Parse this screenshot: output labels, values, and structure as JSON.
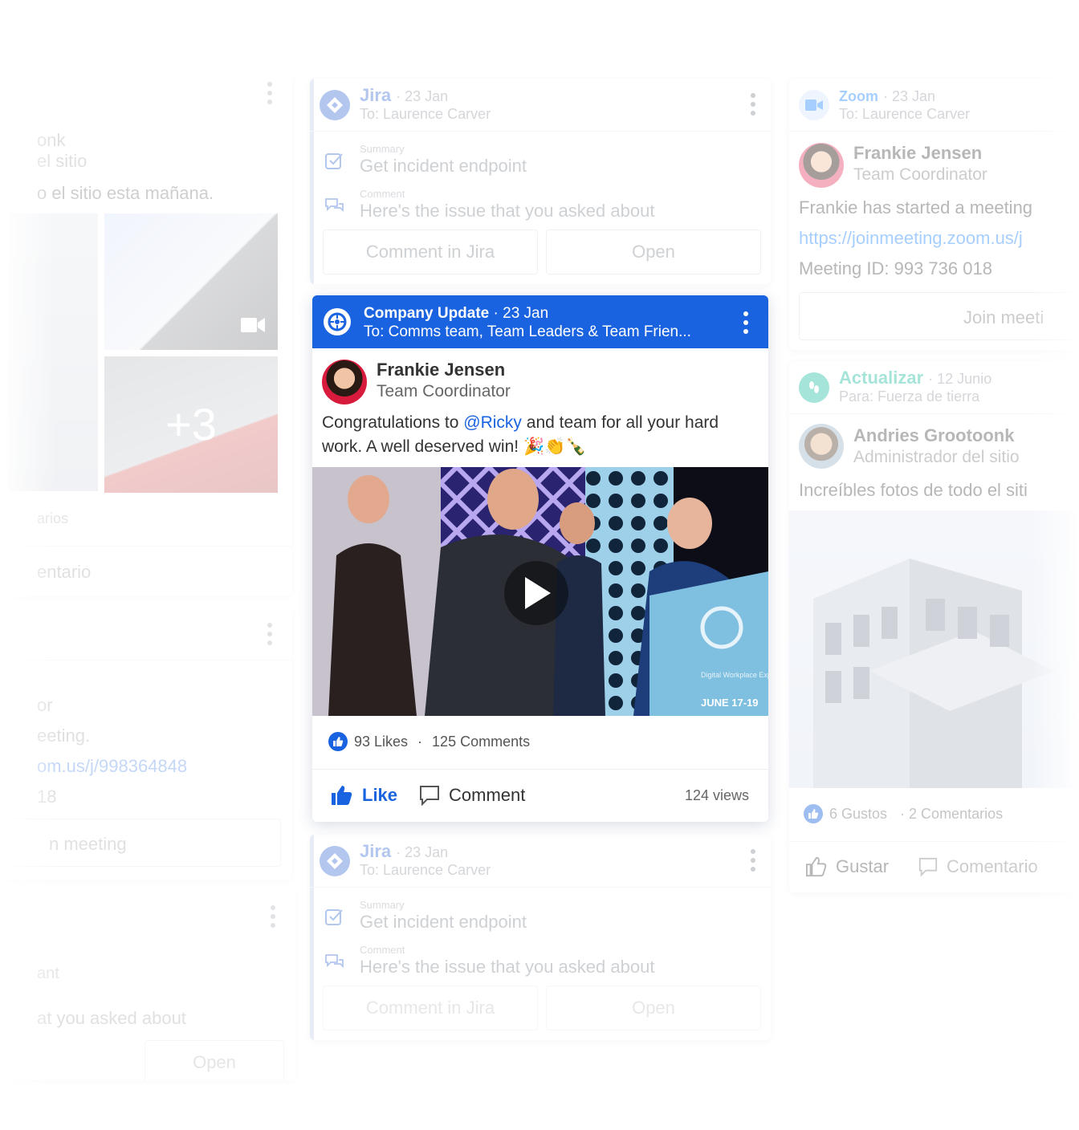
{
  "left_column": {
    "card1": {
      "text_line1": "onk",
      "text_line2": "el sitio",
      "text_line3": "o el sitio esta mañana.",
      "more_photos": "+3",
      "stat_fragment": "arios",
      "action_fragment": "entario"
    },
    "card2": {
      "line1": "or",
      "line2": "eeting.",
      "link": "om.us/j/998364848",
      "line4": "18",
      "button": "n meeting"
    },
    "card3": {
      "line1": "ant",
      "line2": "at you asked about",
      "button": "Open"
    }
  },
  "center_column": {
    "jira_top": {
      "app": "Jira",
      "date": "· 23 Jan",
      "to": "To: Laurence Carver",
      "summary_label": "Summary",
      "summary_value": "Get incident endpoint",
      "comment_label": "Comment",
      "comment_value": "Here's the issue that you asked about",
      "btn_comment": "Comment in Jira",
      "btn_open": "Open"
    },
    "company_update": {
      "title": "Company Update",
      "date": "· 23 Jan",
      "to": "To: Comms team, Team Leaders & Team Frien...",
      "author": "Frankie Jensen",
      "role": "Team Coordinator",
      "text_before": "Congratulations to ",
      "mention": "@Ricky",
      "text_after": " and team for all your hard work. A well deserved win! 🎉👏🍾",
      "likes": "93 Likes",
      "separator": "·",
      "comments": "125 Comments",
      "like_label": "Like",
      "comment_label": "Comment",
      "views": "124 views",
      "video_banner": "Digital Workplace Experience",
      "video_date": "JUNE 17-19"
    },
    "jira_bottom": {
      "app": "Jira",
      "date": "· 23 Jan",
      "to": "To: Laurence Carver",
      "summary_label": "Summary",
      "summary_value": "Get incident endpoint",
      "comment_label": "Comment",
      "comment_value": "Here's the issue that you asked about",
      "btn_comment": "Comment in Jira",
      "btn_open": "Open"
    }
  },
  "right_column": {
    "zoom": {
      "app": "Zoom",
      "date": "· 23 Jan",
      "to": "To: Laurence Carver",
      "author": "Frankie Jensen",
      "role": "Team Coordinator",
      "text": "Frankie has started a meeting",
      "link": "https://joinmeeting.zoom.us/j",
      "meeting_id": "Meeting ID: 993 736 018",
      "button": "Join meeti"
    },
    "actualizar": {
      "app": "Actualizar",
      "date": "· 12 Junio",
      "to": "Para: Fuerza de tierra",
      "author": "Andries Grootoonk",
      "role": "Administrador del sitio",
      "text": "Increíbles fotos de todo el siti",
      "likes": "6 Gustos",
      "comments": "· 2 Comentarios",
      "like_label": "Gustar",
      "comment_label": "Comentario"
    }
  },
  "colors": {
    "brand_blue": "#1a63e0",
    "jira_blue": "#4a78d8",
    "zoom_blue": "#2d8cff",
    "actualizar_teal": "#2bbfa4"
  }
}
